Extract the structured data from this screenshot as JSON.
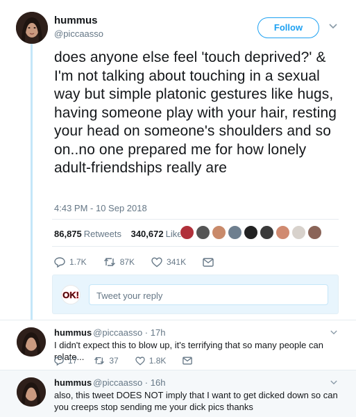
{
  "tweet": {
    "name": "hummus",
    "handle": "@piccaasso",
    "follow_label": "Follow",
    "text": "does anyone else feel 'touch deprived?' & I'm not talking about touching in a sexual way but simple platonic gestures like hugs, having someone play with your hair, resting your head on someone's shoulders and so on..no one prepared me for how lonely adult-friendships really are",
    "timestamp": "4:43 PM - 10 Sep 2018",
    "retweets_count": "86,875",
    "retweets_label": "Retweets",
    "likes_count": "340,672",
    "likes_label": "Likes",
    "actions": {
      "replies": "1.7K",
      "retweets": "87K",
      "likes": "341K"
    }
  },
  "reply_box": {
    "placeholder": "Tweet your reply",
    "logo_text": "OK!"
  },
  "replies": [
    {
      "name": "hummus",
      "meta": "@piccaasso · 17h",
      "text": "I didn't expect this to blow up, it's terrifying that so many people can relate...",
      "actions": {
        "replies": "17",
        "retweets": "37",
        "likes": "1.8K"
      }
    },
    {
      "name": "hummus",
      "meta": "@piccaasso · 16h",
      "text": "also, this tweet DOES NOT imply that I want to get dicked down so can you creeps stop sending me your dick pics thanks"
    }
  ],
  "colors": {
    "accent": "#1da1f2",
    "muted": "#657786",
    "thread_line": "#c4e6f9",
    "reply_bg": "#e8f5fd"
  }
}
